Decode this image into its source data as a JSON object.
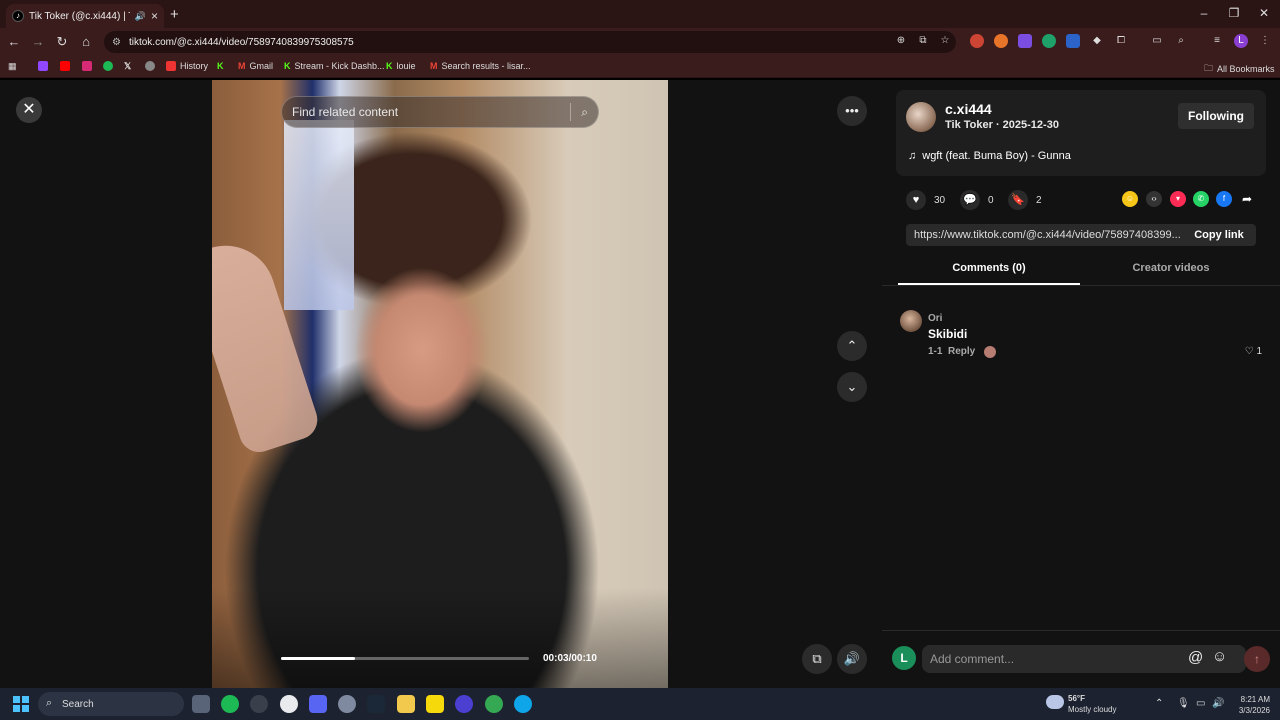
{
  "browser": {
    "tab_title": "Tik Toker (@c.xi444) | TikTok",
    "tab_audio_icon": "speaker-icon",
    "url": "tiktok.com/@c.xi444/video/7589740839975308575",
    "bookmarks": [
      "History",
      "Gmail",
      "Stream - Kick Dashb...",
      "louie",
      "Search results - lisar..."
    ],
    "all_bookmarks": "All Bookmarks",
    "profile_letter": "L"
  },
  "video": {
    "search_placeholder": "Find related content",
    "time": "00:03/00:10",
    "progress": 0.3
  },
  "author": {
    "username": "c.xi444",
    "subline": "Tik Toker · 2025-12-30",
    "follow_label": "Following",
    "music": "wgft (feat. Buma Boy) - Gunna"
  },
  "stats": {
    "likes": "30",
    "comments": "0",
    "saves": "2"
  },
  "share": {
    "link": "https://www.tiktok.com/@c.xi444/video/75897408399...",
    "copy_label": "Copy link"
  },
  "tabs": {
    "comments": "Comments (0)",
    "creator_videos": "Creator videos"
  },
  "comment": {
    "author": "Ori",
    "text": "Skibidi",
    "date": "1-1",
    "reply": "Reply",
    "likes": "1"
  },
  "comment_input": {
    "placeholder": "Add comment...",
    "user_letter": "L"
  },
  "taskbar": {
    "search": "Search",
    "weather_temp": "56°F",
    "weather_desc": "Mostly cloudy",
    "time": "8:21 AM",
    "date": "3/3/2026"
  },
  "colors": {
    "browser_chrome": "#3a1c1c",
    "page_bg": "#121212",
    "accent": "#fe2c55"
  }
}
